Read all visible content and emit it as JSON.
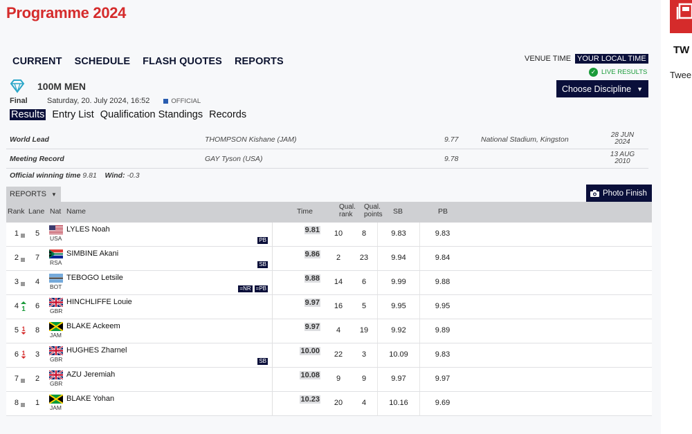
{
  "page_title": "Programme 2024",
  "nav": [
    "CURRENT",
    "SCHEDULE",
    "FLASH QUOTES",
    "REPORTS"
  ],
  "timezone": {
    "venue": "VENUE TIME",
    "local": "YOUR LOCAL TIME"
  },
  "live_results": "LIVE RESULTS",
  "choose_discipline": "Choose Discipline",
  "event": {
    "name": "100M MEN",
    "phase": "Final",
    "date": "Saturday, 20. July 2024, 16:52",
    "status": "OFFICIAL"
  },
  "tabs": [
    "Results",
    "Entry List",
    "Qualification Standings",
    "Records"
  ],
  "records": [
    {
      "type": "World Lead",
      "athlete": "THOMPSON Kishane (JAM)",
      "value": "9.77",
      "venue": "National Stadium, Kingston",
      "date_line1": "28 JUN",
      "date_line2": "2024"
    },
    {
      "type": "Meeting Record",
      "athlete": "GAY Tyson (USA)",
      "value": "9.78",
      "venue": "",
      "date_line1": "13 AUG",
      "date_line2": "2010"
    }
  ],
  "winning": {
    "label": "Official winning time",
    "time": "9.81",
    "wind_label": "Wind:",
    "wind": "-0.3"
  },
  "reports_label": "REPORTS",
  "photo_finish": "Photo Finish",
  "headers": {
    "rank": "Rank",
    "lane": "Lane",
    "nat": "Nat",
    "name": "Name",
    "time": "Time",
    "qrank_1": "Qual.",
    "qrank_2": "rank",
    "qpts_1": "Qual.",
    "qpts_2": "points",
    "sb": "SB",
    "pb": "PB"
  },
  "results": [
    {
      "rank": "1",
      "move": "same",
      "lane": "5",
      "flag": "USA",
      "nat": "USA",
      "name": "LYLES Noah",
      "badges": [
        "PB"
      ],
      "time": "9.81",
      "qrank": "10",
      "qpts": "8",
      "sb": "9.83",
      "pb": "9.83"
    },
    {
      "rank": "2",
      "move": "same",
      "lane": "7",
      "flag": "RSA",
      "nat": "RSA",
      "name": "SIMBINE Akani",
      "badges": [
        "SB"
      ],
      "time": "9.86",
      "qrank": "2",
      "qpts": "23",
      "sb": "9.94",
      "pb": "9.84"
    },
    {
      "rank": "3",
      "move": "same",
      "lane": "4",
      "flag": "BOT",
      "nat": "BOT",
      "name": "TEBOGO Letsile",
      "badges": [
        "=NR",
        "=PB"
      ],
      "time": "9.88",
      "qrank": "14",
      "qpts": "6",
      "sb": "9.99",
      "pb": "9.88"
    },
    {
      "rank": "4",
      "move": "up",
      "lane": "6",
      "flag": "GBR",
      "nat": "GBR",
      "name": "HINCHLIFFE Louie",
      "badges": [],
      "time": "9.97",
      "qrank": "16",
      "qpts": "5",
      "sb": "9.95",
      "pb": "9.95"
    },
    {
      "rank": "5",
      "move": "down",
      "lane": "8",
      "flag": "JAM",
      "nat": "JAM",
      "name": "BLAKE Ackeem",
      "badges": [],
      "time": "9.97",
      "qrank": "4",
      "qpts": "19",
      "sb": "9.92",
      "pb": "9.89"
    },
    {
      "rank": "6",
      "move": "down",
      "lane": "3",
      "flag": "GBR",
      "nat": "GBR",
      "name": "HUGHES Zharnel",
      "badges": [
        "SB"
      ],
      "time": "10.00",
      "qrank": "22",
      "qpts": "3",
      "sb": "10.09",
      "pb": "9.83"
    },
    {
      "rank": "7",
      "move": "same",
      "lane": "2",
      "flag": "GBR",
      "nat": "GBR",
      "name": "AZU Jeremiah",
      "badges": [],
      "time": "10.08",
      "qrank": "9",
      "qpts": "9",
      "sb": "9.97",
      "pb": "9.97"
    },
    {
      "rank": "8",
      "move": "same",
      "lane": "1",
      "flag": "JAM",
      "nat": "JAM",
      "name": "BLAKE Yohan",
      "badges": [],
      "time": "10.23",
      "qrank": "20",
      "qpts": "4",
      "sb": "10.16",
      "pb": "9.69"
    }
  ],
  "sidebar": {
    "title": "TW",
    "text": "Twee"
  },
  "colors": {
    "brand_red": "#d52b2b",
    "navy": "#0a0f3a",
    "live_green": "#1a9b3a",
    "move_up": "#1a9b3a",
    "move_down": "#d52b2b"
  }
}
